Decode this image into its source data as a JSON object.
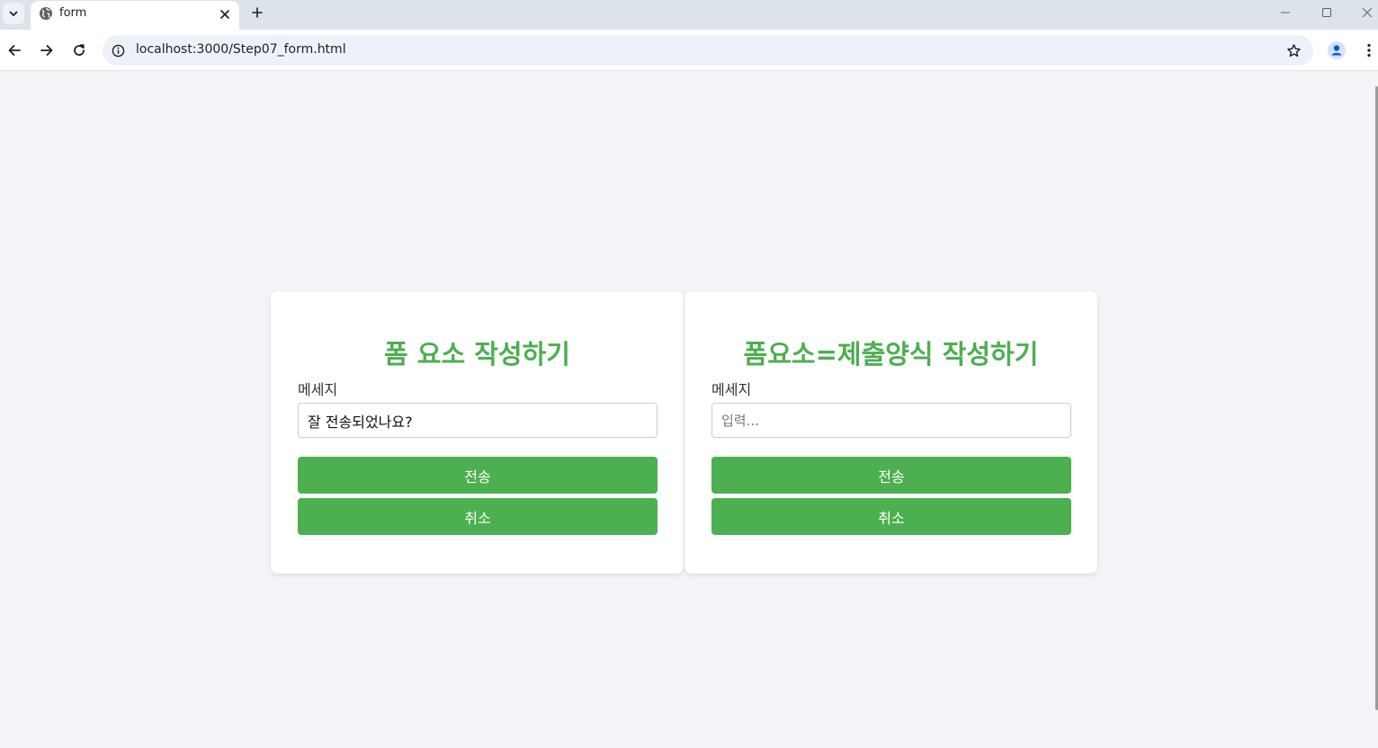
{
  "browser": {
    "tab_title": "form",
    "url": "localhost:3000/Step07_form.html"
  },
  "forms": [
    {
      "title": "폼 요소 작성하기",
      "label": "메세지",
      "input_value": "잘 전송되었나요?",
      "input_placeholder": "",
      "submit_label": "전송",
      "cancel_label": "취소"
    },
    {
      "title": "폼요소=제출양식 작성하기",
      "label": "메세지",
      "input_value": "",
      "input_placeholder": "입력...",
      "submit_label": "전송",
      "cancel_label": "취소"
    }
  ],
  "colors": {
    "accent": "#4caf50",
    "page_background": "#f4f4f8",
    "card_background": "#ffffff"
  }
}
